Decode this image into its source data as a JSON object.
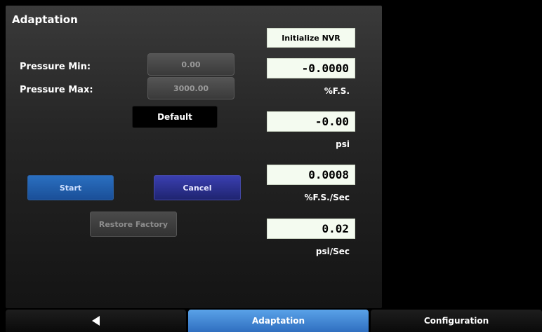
{
  "screen": {
    "title": "Adaptation"
  },
  "fields": {
    "pressure_min_label": "Pressure Min:",
    "pressure_min_value": "0.00",
    "pressure_max_label": "Pressure Max:",
    "pressure_max_value": "3000.00"
  },
  "buttons": {
    "default": "Default",
    "start": "Start",
    "cancel": "Cancel",
    "restore_factory": "Restore Factory",
    "initialize_nvr": "Initialize NVR"
  },
  "readouts": [
    {
      "value": "-0.0000",
      "unit": "%F.S."
    },
    {
      "value": "-0.00",
      "unit": "psi"
    },
    {
      "value": "0.0008",
      "unit": "%F.S./Sec"
    },
    {
      "value": "0.02",
      "unit": "psi/Sec"
    }
  ],
  "tabs": {
    "back_icon": "back-arrow-icon",
    "adaptation": "Adaptation",
    "configuration": "Configuration"
  },
  "colors": {
    "start_button": "#1f5fae",
    "cancel_button": "#2a2f8a",
    "active_tab": "#3a86d6",
    "readout_bg": "#f4fbf0"
  }
}
